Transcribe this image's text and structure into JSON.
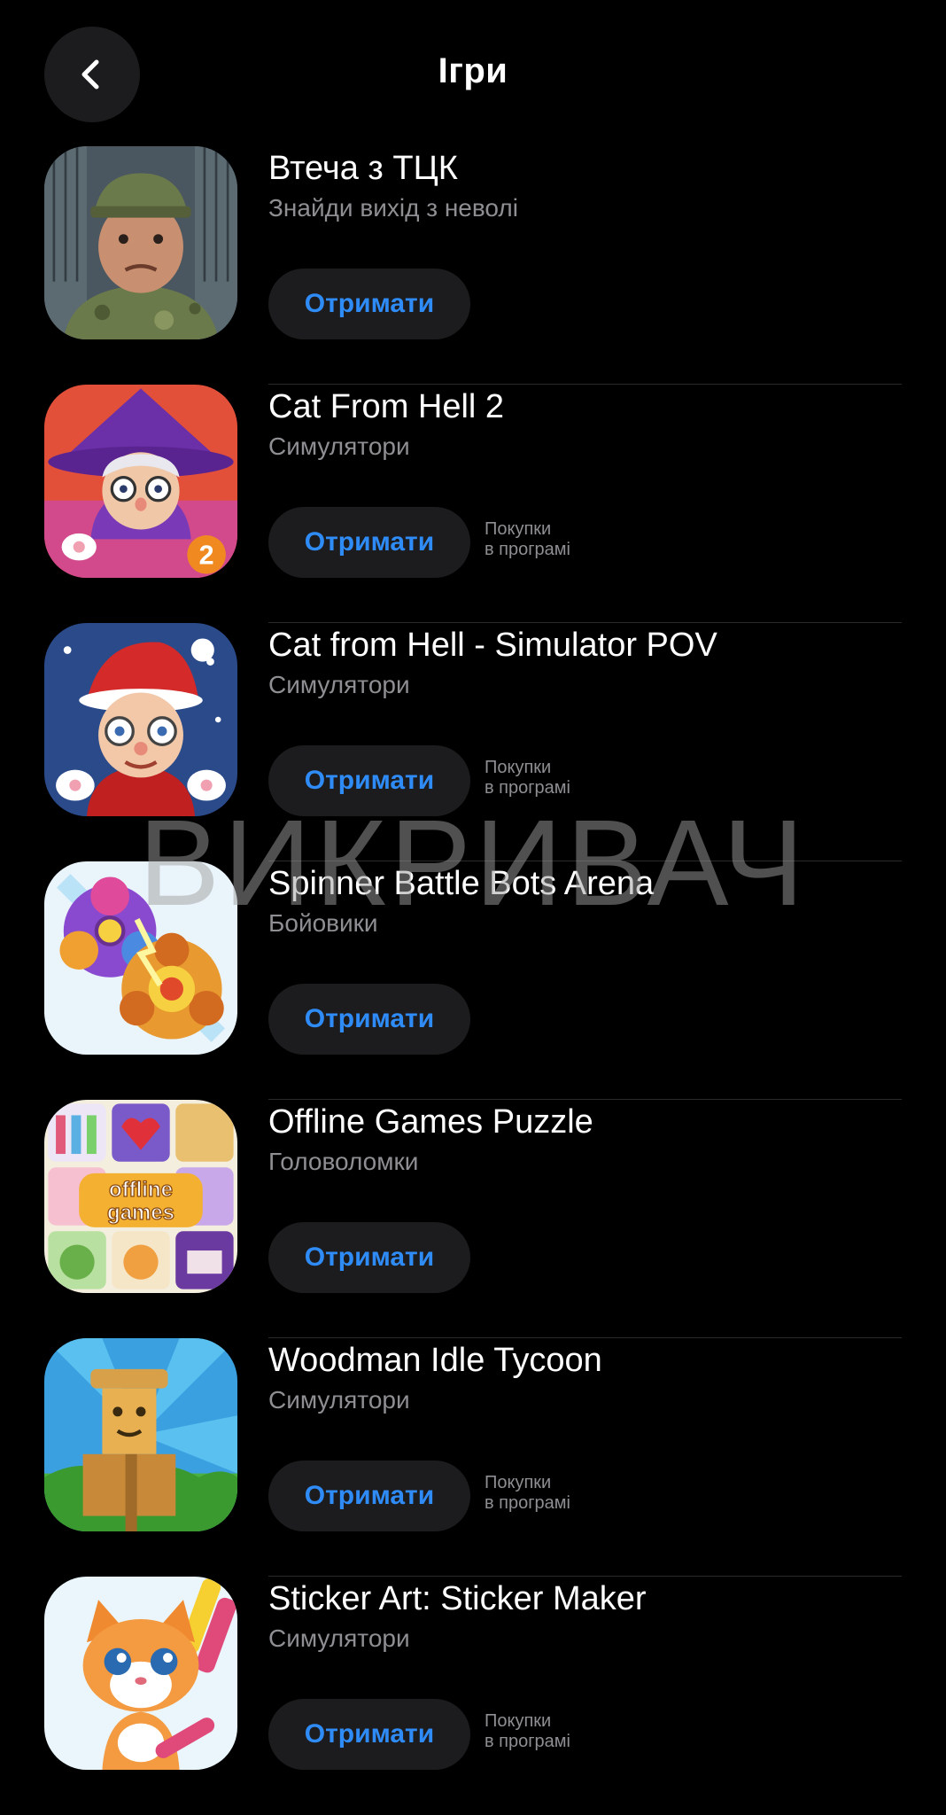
{
  "header": {
    "title": "Ігри"
  },
  "get_label": "Отримати",
  "apps": [
    {
      "name": "Втеча з ТЦК",
      "subtitle": "Знайди вихід з неволі",
      "iap_line1": "",
      "iap_line2": ""
    },
    {
      "name": "Cat From Hell 2",
      "subtitle": "Симулятори",
      "iap_line1": "Покупки",
      "iap_line2": "в програмі"
    },
    {
      "name": "Cat from Hell - Simulator POV",
      "subtitle": "Симулятори",
      "iap_line1": "Покупки",
      "iap_line2": "в програмі"
    },
    {
      "name": "Spinner Battle Bots Arena",
      "subtitle": "Бойовики",
      "iap_line1": "",
      "iap_line2": ""
    },
    {
      "name": "Offline Games Puzzle",
      "subtitle": "Головоломки",
      "iap_line1": "",
      "iap_line2": ""
    },
    {
      "name": "Woodman Idle Tycoon",
      "subtitle": "Симулятори",
      "iap_line1": "Покупки",
      "iap_line2": "в програмі"
    },
    {
      "name": "Sticker Art: Sticker Maker",
      "subtitle": "Симулятори",
      "iap_line1": "Покупки",
      "iap_line2": "в програмі"
    }
  ],
  "icons": {
    "back": "chevron-left-icon",
    "apps": [
      "soldier-app-icon",
      "grandma-witch-app-icon",
      "grandma-santa-app-icon",
      "spinner-app-icon",
      "puzzle-collage-app-icon",
      "woodman-app-icon",
      "cat-sticker-app-icon"
    ]
  },
  "watermark": "ВИКРИВАЧ",
  "colors": {
    "background": "#000000",
    "button_bg": "#1c1c1e",
    "accent": "#2f8cf7",
    "secondary_text": "#8e8e93"
  }
}
